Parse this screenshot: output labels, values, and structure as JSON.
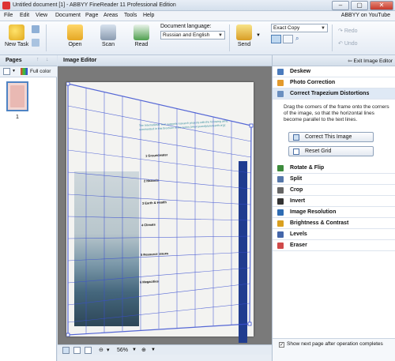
{
  "window": {
    "title": "Untitled document [1] - ABBYY FineReader 11 Professional Edition"
  },
  "menu": {
    "items": [
      "File",
      "Edit",
      "View",
      "Document",
      "Page",
      "Areas",
      "Tools",
      "Help"
    ],
    "youtube": "ABBYY on YouTube"
  },
  "toolbar": {
    "new_task": "New Task",
    "open": "Open",
    "scan": "Scan",
    "read": "Read",
    "doc_lang_label": "Document language:",
    "doc_lang_value": "Russian and English",
    "send": "Send",
    "copy_mode": "Exact Copy",
    "redo": "Redo",
    "undo": "Undo"
  },
  "pages": {
    "title": "Pages",
    "color_mode": "Full color",
    "page_number": "1"
  },
  "editor": {
    "title": "Image Editor",
    "zoom": "56%"
  },
  "right": {
    "exit": "Exit Image Editor",
    "sections": [
      {
        "label": "Deskew",
        "icon": "deskew-icon",
        "color": "#4a7bbd"
      },
      {
        "label": "Photo Correction",
        "icon": "photo-correction-icon",
        "color": "#e39a2c"
      },
      {
        "label": "Correct Trapezium Distortions",
        "icon": "trapezium-icon",
        "color": "#6a8fc0"
      }
    ],
    "trap_desc": "Drag the corners of the frame onto the corners of the image, so that the horizontal lines become parallel to the text lines.",
    "correct_btn": "Correct This Image",
    "reset_btn": "Reset Grid",
    "tools": [
      {
        "label": "Rotate & Flip",
        "icon": "rotate-icon",
        "color": "#3d8c3d"
      },
      {
        "label": "Split",
        "icon": "split-icon",
        "color": "#5577aa"
      },
      {
        "label": "Crop",
        "icon": "crop-icon",
        "color": "#666666"
      },
      {
        "label": "Invert",
        "icon": "invert-icon",
        "color": "#333333"
      },
      {
        "label": "Image Resolution",
        "icon": "resolution-icon",
        "color": "#2e6cb3"
      },
      {
        "label": "Brightness & Contrast",
        "icon": "brightness-icon",
        "color": "#d9a020"
      },
      {
        "label": "Levels",
        "icon": "levels-icon",
        "color": "#4466aa"
      },
      {
        "label": "Eraser",
        "icon": "eraser-icon",
        "color": "#d04a4a"
      }
    ],
    "show_next": "Show next page after operation completes"
  },
  "doc_page": {
    "header": "The International Year supports research projects with the following aims, summarized in this brochure in the series (www.yearofplanetearth.org):",
    "topics": [
      "1 Groundwater",
      "2 Hazards",
      "3 Earth & Health",
      "4 Climate",
      "5 Resource issues",
      "6 Megacities"
    ]
  }
}
